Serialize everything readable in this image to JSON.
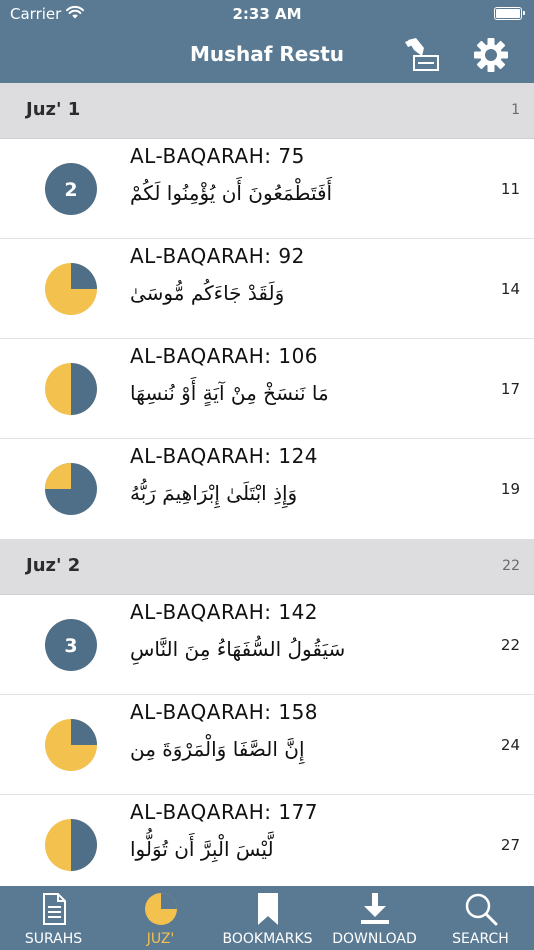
{
  "status": {
    "carrier": "Carrier",
    "time": "2:33 AM"
  },
  "nav": {
    "title": "Mushaf Restu"
  },
  "colors": {
    "accent": "#5a7a93",
    "yellow": "#f2c14e",
    "slate": "#4f6f89"
  },
  "sections": [
    {
      "title": "Juz' 1",
      "page": "1",
      "rows": [
        {
          "icon": "badge",
          "badge": "2",
          "surah": "AL-BAQARAH:  75",
          "arabic": "أَفَتَطْمَعُونَ أَن يُؤْمِنُوا لَكُمْ",
          "page": "11"
        },
        {
          "icon": "pie",
          "fraction": 0.75,
          "surah": "AL-BAQARAH:  92",
          "arabic": "وَلَقَدْ جَاءَكُم مُّوسَىٰ",
          "page": "14"
        },
        {
          "icon": "pie",
          "fraction": 0.5,
          "surah": "AL-BAQARAH:  106",
          "arabic": "مَا نَنسَخْ مِنْ آيَةٍ أَوْ نُنسِهَا",
          "page": "17"
        },
        {
          "icon": "pie",
          "fraction": 0.25,
          "surah": "AL-BAQARAH:  124",
          "arabic": "وَإِذِ ابْتَلَىٰ إِبْرَاهِيمَ رَبُّهُ",
          "page": "19"
        }
      ]
    },
    {
      "title": "Juz' 2",
      "page": "22",
      "rows": [
        {
          "icon": "badge",
          "badge": "3",
          "surah": "AL-BAQARAH:  142",
          "arabic": "سَيَقُولُ السُّفَهَاءُ مِنَ النَّاسِ",
          "page": "22"
        },
        {
          "icon": "pie",
          "fraction": 0.75,
          "surah": "AL-BAQARAH:  158",
          "arabic": "إِنَّ الصَّفَا وَالْمَرْوَةَ مِن",
          "page": "24"
        },
        {
          "icon": "pie",
          "fraction": 0.5,
          "surah": "AL-BAQARAH:  177",
          "arabic": "لَّيْسَ الْبِرَّ أَن تُوَلُّوا",
          "page": "27"
        }
      ]
    }
  ],
  "tabs": [
    {
      "label": "SURAHS",
      "icon": "document-icon",
      "active": false
    },
    {
      "label": "JUZ'",
      "icon": "juz-pie-icon",
      "active": true
    },
    {
      "label": "BOOKMARKS",
      "icon": "bookmark-icon",
      "active": false
    },
    {
      "label": "DOWNLOAD",
      "icon": "download-icon",
      "active": false
    },
    {
      "label": "SEARCH",
      "icon": "search-icon",
      "active": false
    }
  ]
}
